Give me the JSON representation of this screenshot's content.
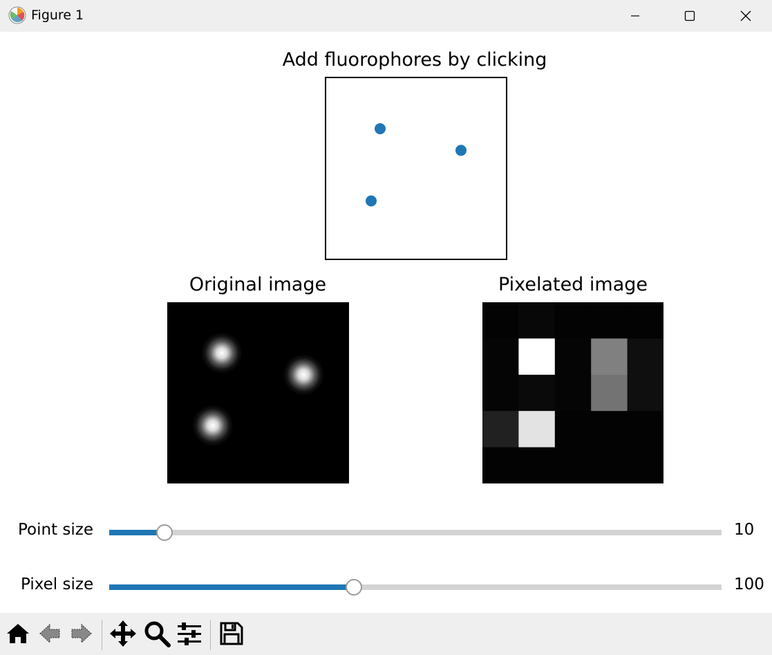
{
  "window": {
    "title": "Figure 1",
    "icons": [
      "matplotlib-logo-icon",
      "minimize-icon",
      "maximize-icon",
      "close-icon"
    ]
  },
  "plots": {
    "scatter_title": "Add fluorophores by clicking",
    "original_title": "Original image",
    "pixelated_title": "Pixelated image"
  },
  "chart_data": [
    {
      "type": "scatter",
      "title": "Add fluorophores by clicking",
      "x": [
        0.3,
        0.75,
        0.25
      ],
      "y": [
        0.72,
        0.6,
        0.32
      ],
      "xlim": [
        0,
        1
      ],
      "ylim": [
        0,
        1
      ],
      "axes_visible": false,
      "marker_color": "#1f77b4"
    },
    {
      "type": "heatmap",
      "title": "Original image",
      "colormap": "gray",
      "blobs": [
        {
          "x": 0.3,
          "y": 0.72,
          "intensity": 1.0
        },
        {
          "x": 0.75,
          "y": 0.6,
          "intensity": 1.0
        },
        {
          "x": 0.25,
          "y": 0.32,
          "intensity": 1.0
        }
      ]
    },
    {
      "type": "heatmap",
      "title": "Pixelated image",
      "colormap": "gray",
      "grid": [
        [
          0.01,
          0.03,
          0.01,
          0.01,
          0.01
        ],
        [
          0.02,
          1.0,
          0.02,
          0.5,
          0.06
        ],
        [
          0.02,
          0.04,
          0.02,
          0.45,
          0.06
        ],
        [
          0.13,
          0.89,
          0.01,
          0.01,
          0.01
        ],
        [
          0.01,
          0.01,
          0.01,
          0.01,
          0.01
        ]
      ]
    }
  ],
  "sliders": [
    {
      "label": "Point size",
      "value": "10",
      "fraction": 0.09
    },
    {
      "label": "Pixel size",
      "value": "100",
      "fraction": 0.4
    }
  ],
  "colors": {
    "accent": "#1f77b4",
    "track": "#d3d3d3",
    "chrome": "#efefef"
  },
  "toolbar": {
    "buttons": [
      "home-icon",
      "back-icon",
      "forward-icon",
      "pan-icon",
      "zoom-icon",
      "configure-subplots-icon",
      "save-icon"
    ]
  }
}
